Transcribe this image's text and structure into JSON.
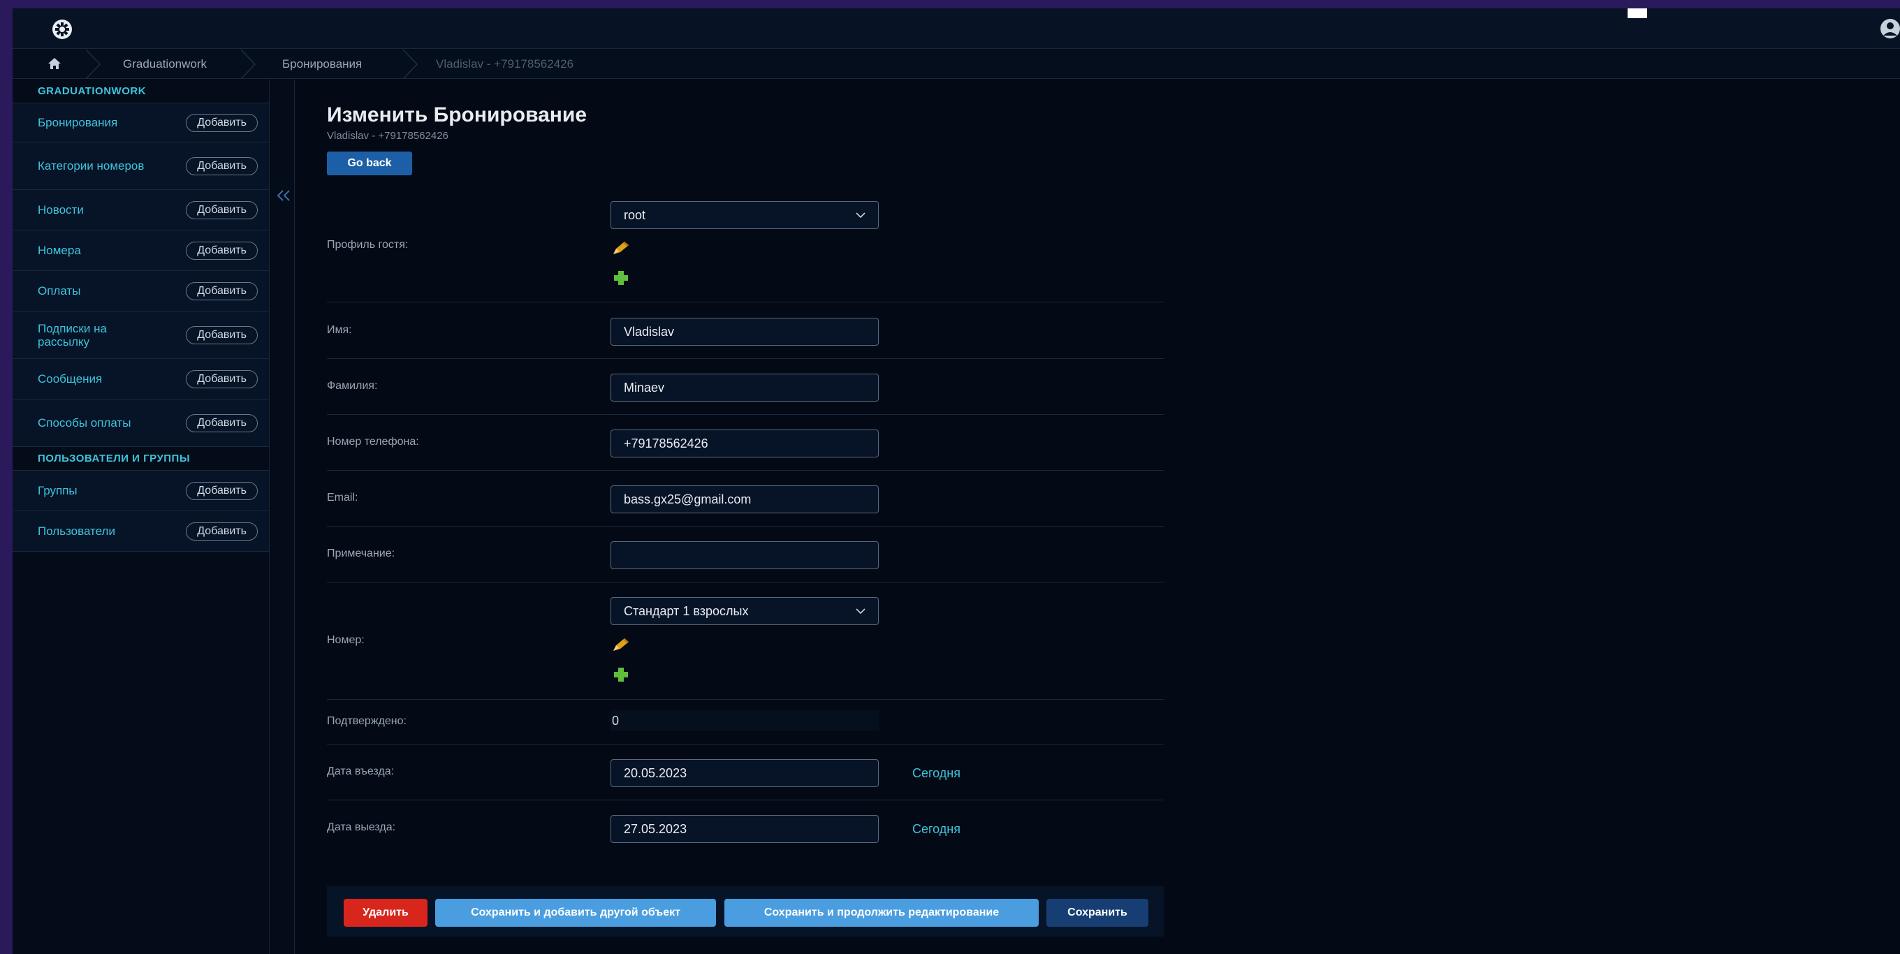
{
  "header": {
    "logo_icon": "gear-icon",
    "user_icon": "user-icon"
  },
  "breadcrumbs": {
    "home_icon": "home-icon",
    "items": [
      "Graduationwork",
      "Бронирования",
      "Vladislav - +79178562426"
    ]
  },
  "sidebar": {
    "sections": [
      {
        "title": "GRADUATIONWORK",
        "items": [
          {
            "label": "Бронирования",
            "add": "Добавить"
          },
          {
            "label": "Категории номеров",
            "add": "Добавить"
          },
          {
            "label": "Новости",
            "add": "Добавить"
          },
          {
            "label": "Номера",
            "add": "Добавить"
          },
          {
            "label": "Оплаты",
            "add": "Добавить"
          },
          {
            "label": "Подписки на рассылку",
            "add": "Добавить"
          },
          {
            "label": "Сообщения",
            "add": "Добавить"
          },
          {
            "label": "Способы оплаты",
            "add": "Добавить"
          }
        ]
      },
      {
        "title": "ПОЛЬЗОВАТЕЛИ И ГРУППЫ",
        "items": [
          {
            "label": "Группы",
            "add": "Добавить"
          },
          {
            "label": "Пользователи",
            "add": "Добавить"
          }
        ]
      }
    ],
    "collapse_icon": "double-chevron-left-icon"
  },
  "main": {
    "title": "Изменить Бронирование",
    "subtitle": "Vladislav - +79178562426",
    "go_back": "Go back",
    "fields": {
      "guest_profile": {
        "label": "Профиль гостя:",
        "value": "root"
      },
      "first_name": {
        "label": "Имя:",
        "value": "Vladislav"
      },
      "last_name": {
        "label": "Фамилия:",
        "value": "Minaev"
      },
      "phone": {
        "label": "Номер телефона:",
        "value": "+79178562426"
      },
      "email": {
        "label": "Email:",
        "value": "bass.gx25@gmail.com"
      },
      "note": {
        "label": "Примечание:",
        "value": ""
      },
      "room": {
        "label": "Номер:",
        "value": "Стандарт 1 взрослых"
      },
      "confirmed": {
        "label": "Подтверждено:",
        "value": "0"
      },
      "checkin": {
        "label": "Дата въезда:",
        "value": "20.05.2023",
        "today": "Сегодня"
      },
      "checkout": {
        "label": "Дата выезда:",
        "value": "27.05.2023",
        "today": "Сегодня"
      }
    },
    "buttons": {
      "delete": "Удалить",
      "save_add": "Сохранить и добавить другой объект",
      "save_continue": "Сохранить и продолжить редактирование",
      "save": "Сохранить"
    }
  },
  "colors": {
    "accent": "#3fc4dc",
    "primary_button": "#1d5fa6",
    "delete_button": "#d9261c",
    "light_button": "#4a9ee0",
    "edit_icon": "#e0a318",
    "add_icon": "#5fbf3c"
  }
}
